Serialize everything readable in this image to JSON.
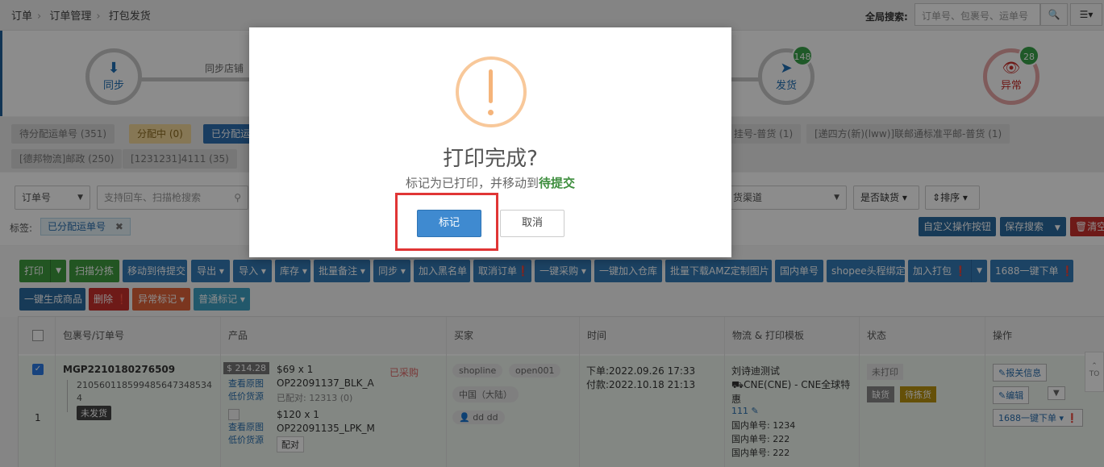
{
  "breadcrumb": [
    "订单",
    "订单管理",
    "打包发货"
  ],
  "global_search": {
    "label": "全局搜索:",
    "placeholder": "订单号、包裹号、运单号"
  },
  "flow": {
    "sync_label": "同步",
    "sync_stores_label": "同步店铺",
    "ship_label": "发货",
    "ship_count": "148",
    "exception_label": "异常",
    "exception_count": "28"
  },
  "status_tags": [
    "待分配运单号 (351)",
    "分配中 (0)",
    "已分配运",
    "挂号-普货 (1)",
    "[递四方(新)(lww)]联邮通标准平邮-普货 (1)",
    "[德邦物流]邮政 (250)",
    "[1231231]4111 (35)"
  ],
  "filters": {
    "order_no_select": "订单号",
    "search_placeholder": "支持回车、扫描枪搜索",
    "channel_select": "货渠道",
    "missing_select": "是否缺货",
    "sort_select": "排序",
    "tag_label": "标签:",
    "active_tag": "已分配运单号",
    "custom_buttons": "自定义操作按钮",
    "save_search": "保存搜索",
    "clear": "清空"
  },
  "toolbar_row1": [
    "打印",
    "扫描分拣",
    "移动到待提交",
    "导出",
    "导入",
    "库存",
    "批量备注",
    "同步",
    "加入黑名单",
    "取消订单",
    "一键采购",
    "一键加入仓库",
    "批量下载AMZ定制图片",
    "国内单号",
    "shopee头程绑定",
    "加入打包",
    "1688一键下单"
  ],
  "toolbar_row2": [
    "一键生成商品",
    "删除",
    "异常标记",
    "普通标记"
  ],
  "table": {
    "headers": [
      "包裹号/订单号",
      "产品",
      "买家",
      "时间",
      "物流 & 打印模板",
      "状态",
      "操作"
    ],
    "row": {
      "package_no": "MGP2210180276509",
      "order_no_line1": "210560118599485647348534",
      "order_no_line2": "8",
      "order_no_line3": "4",
      "row_index": "1",
      "not_shipped": "未发货",
      "price_tag": "$ 214.28",
      "view_image": "查看原图",
      "low_price": "低价货源",
      "item1_qty": "$69 x 1",
      "item1_sku": "OP22091137_BLK_A",
      "item1_match": "已配对: 12313 (0)",
      "purchased": "已采购",
      "item2_qty": "$120 x 1",
      "item2_sku": "OP22091135_LPK_M",
      "match_btn": "配对",
      "buyer_store": "shopline",
      "buyer_id": "open001",
      "buyer_country": "中国（大陆）",
      "buyer_name": "dd dd",
      "order_time": "下单:2022.09.26 17:33",
      "pay_time": "付款:2022.10.18 21:13",
      "logistics_name": "刘诗迪测试",
      "logistics_line": "CNE(CNE) - CNE全球特惠",
      "tracking": "111",
      "domestic1": "国内单号: 1234",
      "domestic2": "国内单号: 222",
      "domestic3": "国内单号: 222",
      "status_unprinted": "未打印",
      "status_missing": "缺货",
      "status_pick": "待拣货",
      "op_customs": "报关信息",
      "op_edit": "编辑",
      "op_1688": "1688一键下单"
    }
  },
  "side_button": "TO",
  "modal": {
    "title": "打印完成?",
    "text_prefix": "标记为已打印，并移动到",
    "text_target": "待提交",
    "ok_label": "标记",
    "cancel_label": "取消"
  }
}
